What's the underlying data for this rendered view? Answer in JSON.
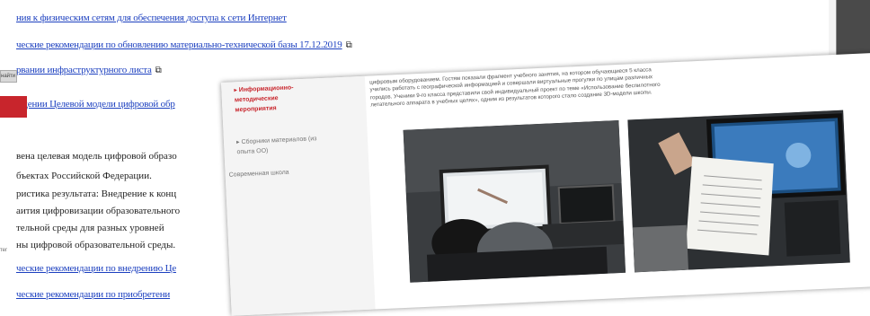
{
  "back": {
    "links": [
      {
        "text": "ния к физическим сетям для обеспечения доступа к сети Интернет"
      },
      {
        "text": "ческие рекомендации по обновлению материально-технической базы 17.12.2019"
      },
      {
        "text": "рвании инфраструктурного листа"
      },
      {
        "text": "ждении Целевой модели цифровой обр"
      }
    ],
    "ext_icon": "⧉",
    "paragraph1": [
      "вена целевая модель цифровой образо",
      "бъектах Российской Федерации."
    ],
    "paragraph2": [
      "ристика результата: Внедрение к конц",
      "аития цифровизации образовательного",
      "тельной среды для разных уровней",
      "ны цифровой образовательной среды."
    ],
    "bottom_links": [
      "ческие рекомендации по внедрению Це",
      "ческие рекомендации по приобретени"
    ],
    "chip_label": "найти",
    "tiny_label": "тег"
  },
  "front": {
    "sidebar": {
      "active_item": [
        "▸ Информационно-",
        "методические",
        "мероприятия"
      ],
      "sub_item": [
        "▸ Сборники материалов (из",
        "опыта ОО)"
      ],
      "footer_item": "Современная школа"
    },
    "text_lines": [
      "цифровым оборудованием. Гостям показали фрагмент учебного занятия, на котором обучающиеся 5 класса",
      "учились работать с географической информацией и совершали виртуальные прогулки по улицам различных",
      "городов. Ученики 9-го класса представили свой индивидуальный проект по теме «Использование беспилотного",
      "летательного аппарата в учебных целях», одним из результатов которого стало создание 3D-модели школы."
    ]
  },
  "colors": {
    "link": "#1b3fbf",
    "accent_red": "#c8252c"
  }
}
